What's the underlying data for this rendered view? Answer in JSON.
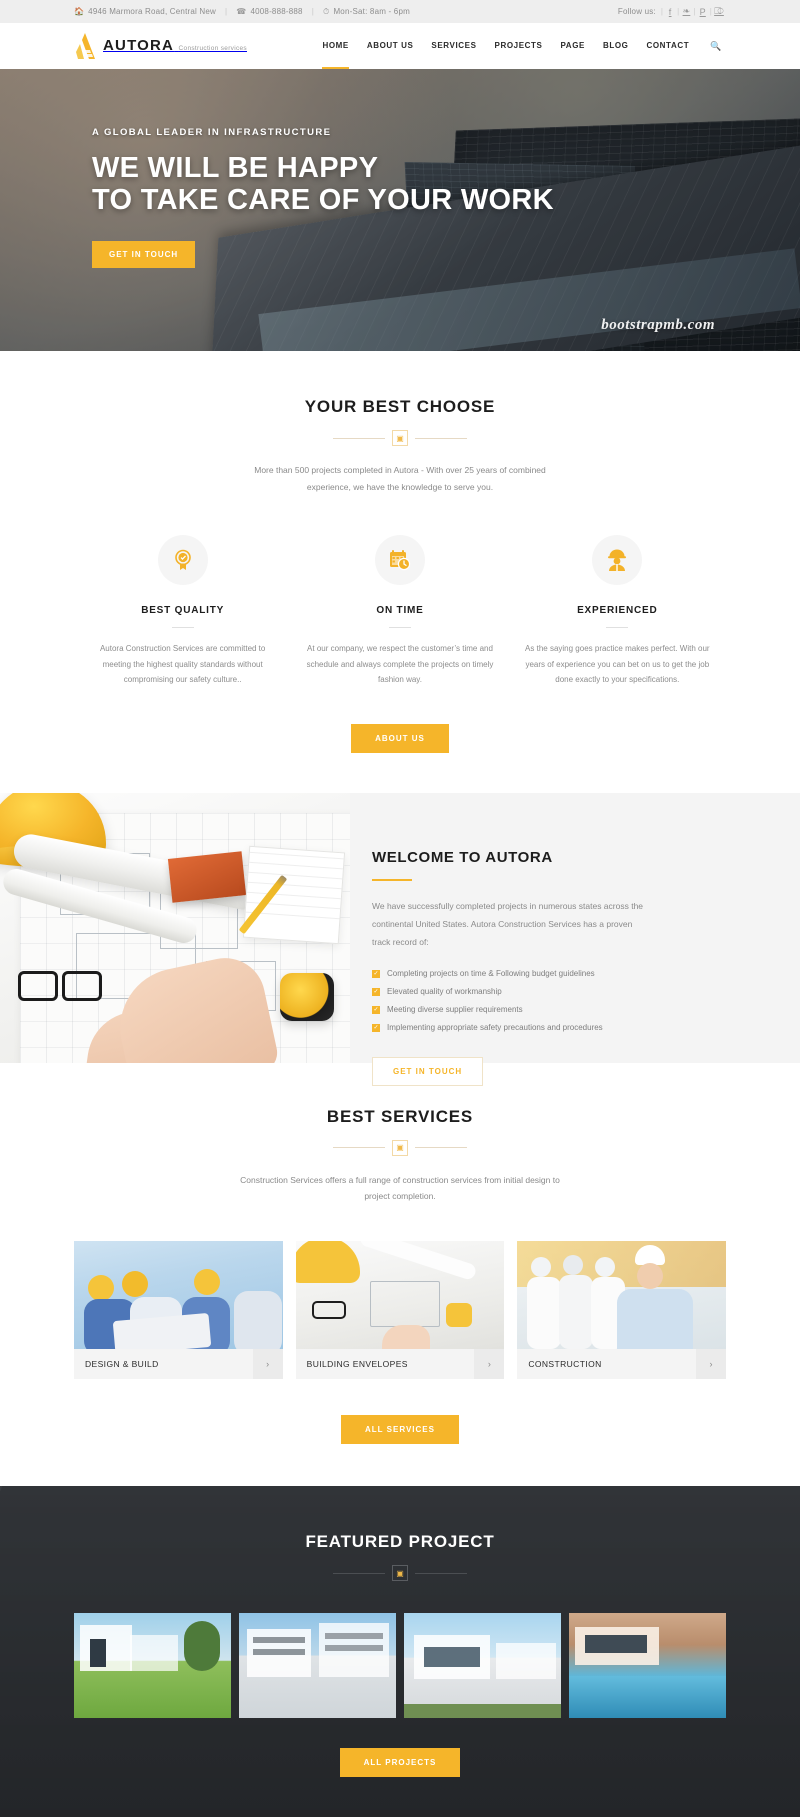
{
  "topbar": {
    "address": "4946 Marmora Road, Central New",
    "phone": "4008-888-888",
    "hours": "Mon-Sat: 8am - 6pm",
    "follow_label": "Follow us:",
    "address_icon": "home-icon",
    "phone_icon": "phone-icon",
    "hours_icon": "clock-icon",
    "socials": [
      {
        "name": "facebook-icon",
        "glyph": "f"
      },
      {
        "name": "twitter-icon",
        "glyph": "❧"
      },
      {
        "name": "pinterest-icon",
        "glyph": "P"
      },
      {
        "name": "rss-icon",
        "glyph": "⎄"
      }
    ]
  },
  "header": {
    "logo_name": "AUTORA",
    "logo_sub": "Construction services",
    "nav": [
      {
        "label": "HOME",
        "active": true
      },
      {
        "label": "ABOUT US",
        "active": false
      },
      {
        "label": "SERVICES",
        "active": false
      },
      {
        "label": "PROJECTS",
        "active": false
      },
      {
        "label": "PAGE",
        "active": false
      },
      {
        "label": "BLOG",
        "active": false
      },
      {
        "label": "CONTACT",
        "active": false
      }
    ],
    "search_icon": "search-icon"
  },
  "hero": {
    "kicker": "A GLOBAL LEADER IN INFRASTRUCTURE",
    "title_line1": "WE WILL BE HAPPY",
    "title_line2": "TO TAKE CARE OF YOUR WORK",
    "cta": "GET IN TOUCH",
    "watermark": "bootstrapmb.com"
  },
  "choose": {
    "title": "YOUR BEST CHOOSE",
    "subtitle": "More than 500 projects completed in Autora - With over 25 years of combined experience, we have the knowledge to serve you.",
    "divider_icon": "certificate-icon",
    "features": [
      {
        "icon": "award-badge-icon",
        "name": "BEST QUALITY",
        "desc": "Autora Construction Services are committed to meeting the highest quality standards without compromising our safety culture.."
      },
      {
        "icon": "calendar-clock-icon",
        "name": "ON TIME",
        "desc": "At our company, we respect the customer’s time and schedule and always complete the projects on timely fashion way."
      },
      {
        "icon": "worker-icon",
        "name": "EXPERIENCED",
        "desc": "As the saying goes practice makes perfect. With our years of experience you can bet on us to get the job done exactly to your specifications."
      }
    ],
    "cta": "ABOUT US"
  },
  "welcome": {
    "title": "WELCOME TO AUTORA",
    "text": "We have successfully completed projects in numerous states across the continental United States. Autora Construction Services has a proven track record of:",
    "items": [
      "Completing projects on time & Following budget guidelines",
      "Elevated quality of workmanship",
      "Meeting diverse supplier requirements",
      "Implementing appropriate safety precautions and procedures"
    ],
    "check_icon": "check-square-icon",
    "cta": "GET IN TOUCH"
  },
  "services": {
    "title": "BEST SERVICES",
    "subtitle": "Construction Services offers a full range of construction services from initial design to project completion.",
    "divider_icon": "certificate-icon",
    "cards": [
      {
        "name": "DESIGN & BUILD",
        "arrow_icon": "chevron-right-icon"
      },
      {
        "name": "BUILDING ENVELOPES",
        "arrow_icon": "chevron-right-icon"
      },
      {
        "name": "CONSTRUCTION",
        "arrow_icon": "chevron-right-icon"
      }
    ],
    "cta": "ALL SERVICES"
  },
  "featured": {
    "title": "FEATURED PROJECT",
    "divider_icon": "certificate-icon",
    "projects": [
      {
        "name": "project-1"
      },
      {
        "name": "project-2"
      },
      {
        "name": "project-3"
      },
      {
        "name": "project-4"
      }
    ],
    "cta": "ALL PROJECTS"
  },
  "colors": {
    "accent": "#f5b52a",
    "dark": "#2c2f33",
    "topbar_bg": "#eeeeee",
    "muted_text": "#8a8a8a"
  }
}
